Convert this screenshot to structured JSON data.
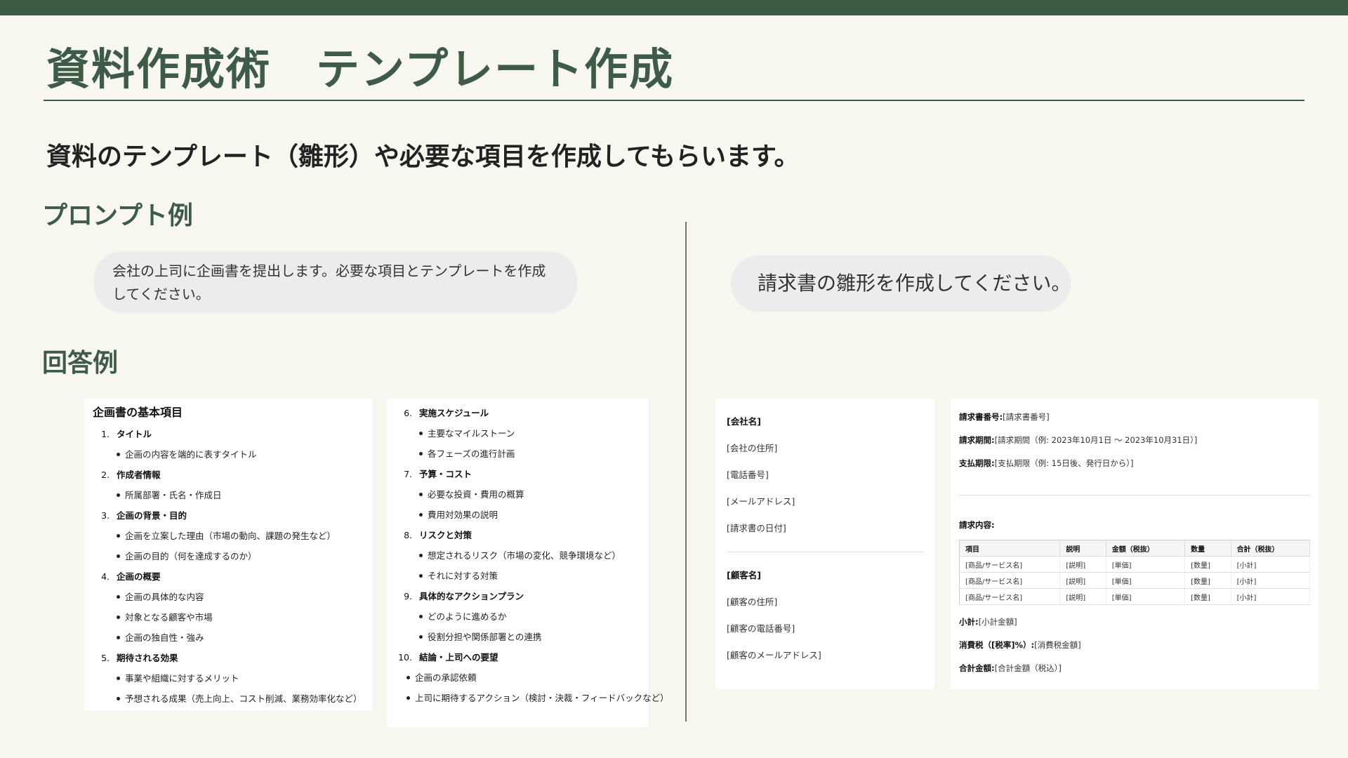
{
  "header": {
    "title": "資料作成術　テンプレート作成",
    "subtitle": "資料のテンプレート（雛形）や必要な項目を作成してもらいます。"
  },
  "sections": {
    "prompt_label": "プロンプト例",
    "answer_label": "回答例"
  },
  "prompts": {
    "left": "会社の上司に企画書を提出します。必要な項目とテンプレートを作成してください。",
    "right": "請求書の雛形を作成してください。"
  },
  "plan": {
    "title": "企画書の基本項目",
    "col1": [
      {
        "num": "1.",
        "label": "タイトル",
        "bullets": [
          "企画の内容を端的に表すタイトル"
        ]
      },
      {
        "num": "2.",
        "label": "作成者情報",
        "bullets": [
          "所属部署・氏名・作成日"
        ]
      },
      {
        "num": "3.",
        "label": "企画の背景・目的",
        "bullets": [
          "企画を立案した理由（市場の動向、課題の発生など）",
          "企画の目的（何を達成するのか）"
        ]
      },
      {
        "num": "4.",
        "label": "企画の概要",
        "bullets": [
          "企画の具体的な内容",
          "対象となる顧客や市場",
          "企画の独自性・強み"
        ]
      },
      {
        "num": "5.",
        "label": "期待される効果",
        "bullets": [
          "事業や組織に対するメリット",
          "予想される成果（売上向上、コスト削減、業務効率化など）"
        ]
      }
    ],
    "col2": [
      {
        "num": "6.",
        "label": "実施スケジュール",
        "bullets": [
          "主要なマイルストーン",
          "各フェーズの進行計画"
        ]
      },
      {
        "num": "7.",
        "label": "予算・コスト",
        "bullets": [
          "必要な投資・費用の概算",
          "費用対効果の説明"
        ]
      },
      {
        "num": "8.",
        "label": "リスクと対策",
        "bullets": [
          "想定されるリスク（市場の変化、競争環境など）",
          "それに対する対策"
        ]
      },
      {
        "num": "9.",
        "label": "具体的なアクションプラン",
        "bullets": [
          "どのように進めるか",
          "役割分担や関係部署との連携"
        ]
      },
      {
        "num": "10.",
        "label": "結論・上司への要望",
        "bullets": []
      }
    ],
    "col2_flat_bullets": [
      "企画の承認依頼",
      "上司に期待するアクション（検討・決裁・フィードバックなど）"
    ]
  },
  "invoice_left": {
    "company_name": "[会社名]",
    "company_lines": [
      "[会社の住所]",
      "[電話番号]",
      "[メールアドレス]",
      "[請求書の日付]"
    ],
    "customer_name": "[顧客名]",
    "customer_lines": [
      "[顧客の住所]",
      "[顧客の電話番号]",
      "[顧客のメールアドレス]"
    ]
  },
  "invoice_right": {
    "number_label": "請求書番号:",
    "number_value": "[請求書番号]",
    "period_label": "請求期間:",
    "period_value": "[請求期間（例: 2023年10月1日 ～ 2023年10月31日）]",
    "due_label": "支払期限:",
    "due_value": "[支払期限（例: 15日後、発行日から）]",
    "content_label": "請求内容:",
    "table_headers": [
      "項目",
      "説明",
      "金額（税抜）",
      "数量",
      "合計（税抜）"
    ],
    "table_rows": [
      [
        "[商品/サービス名]",
        "[説明]",
        "[単価]",
        "[数量]",
        "[小計]"
      ],
      [
        "[商品/サービス名]",
        "[説明]",
        "[単価]",
        "[数量]",
        "[小計]"
      ],
      [
        "[商品/サービス名]",
        "[説明]",
        "[単価]",
        "[数量]",
        "[小計]"
      ]
    ],
    "subtotal_label": "小計:",
    "subtotal_value": "[小計金額]",
    "tax_label": "消費税（[税率]%）:",
    "tax_value": "[消費税金額]",
    "total_label": "合計金額:",
    "total_value": "[合計金額（税込）]"
  },
  "colors": {
    "accent": "#3e5b46",
    "background": "#f7f6ef"
  }
}
